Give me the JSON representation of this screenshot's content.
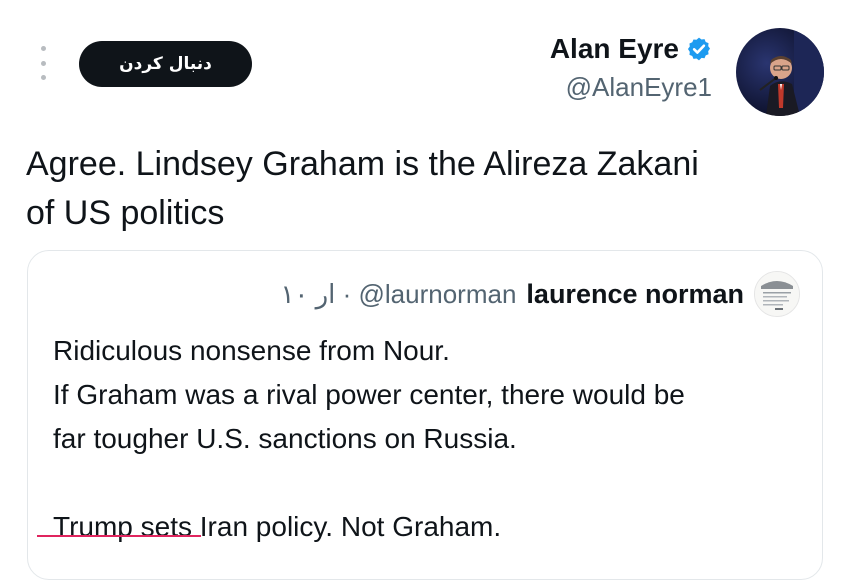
{
  "header": {
    "follow_label": "دنبال کردن",
    "author_name": "Alan Eyre",
    "author_handle": "@AlanEyre1",
    "verified_icon": "verified-badge-icon",
    "more_icon": "more-vertical-icon"
  },
  "tweet": {
    "lines": [
      "Agree. Lindsey Graham is the Alireza Zakani",
      "of US politics"
    ]
  },
  "quote": {
    "name": "laurence norman",
    "handle_meta": "۱۰ ار · @laurnorman",
    "lines": [
      "Ridiculous nonsense from Nour.",
      "If Graham was a rival power center, there would be",
      "far tougher U.S. sanctions on Russia.",
      "",
      "Trump sets Iran policy. Not Graham."
    ]
  },
  "colors": {
    "text": "#0f1419",
    "muted": "#536471",
    "button_bg": "#0f1419",
    "verified": "#1d9bf0",
    "border": "#e3e7ea"
  }
}
